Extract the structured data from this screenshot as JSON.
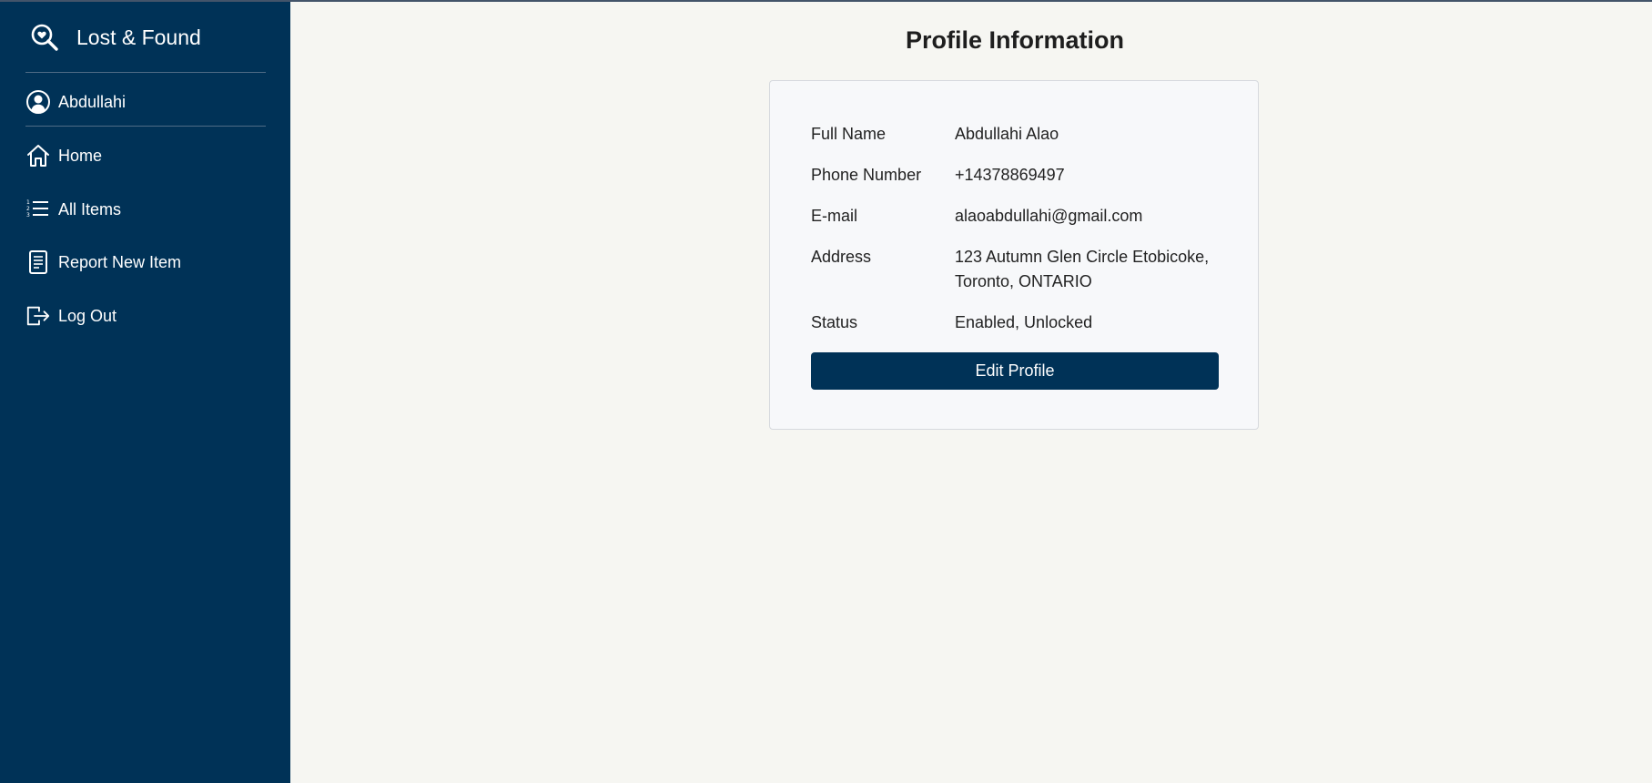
{
  "app": {
    "title": "Lost & Found",
    "brand_icon": "search-heart-icon"
  },
  "user": {
    "name": "Abdullahi",
    "icon": "user-circle-icon"
  },
  "sidebar": {
    "items": [
      {
        "label": "Home",
        "icon": "home-icon"
      },
      {
        "label": "All Items",
        "icon": "list-icon"
      },
      {
        "label": "Report New Item",
        "icon": "document-icon"
      },
      {
        "label": "Log Out",
        "icon": "logout-icon"
      }
    ]
  },
  "profile": {
    "heading": "Profile Information",
    "fields": [
      {
        "label": "Full Name",
        "value": "Abdullahi Alao"
      },
      {
        "label": "Phone Number",
        "value": "+14378869497"
      },
      {
        "label": "E-mail",
        "value": "alaoabdullahi@gmail.com"
      },
      {
        "label": "Address",
        "value_line1": "123 Autumn Glen Circle Etobicoke,",
        "value_line2": "Toronto, ONTARIO"
      },
      {
        "label": "Status",
        "value": "Enabled, Unlocked"
      }
    ],
    "edit_button_label": "Edit Profile"
  },
  "colors": {
    "sidebar_bg": "#003257",
    "page_bg": "#f6f6f2",
    "card_bg": "#f7f8fa",
    "button_bg": "#003257"
  }
}
